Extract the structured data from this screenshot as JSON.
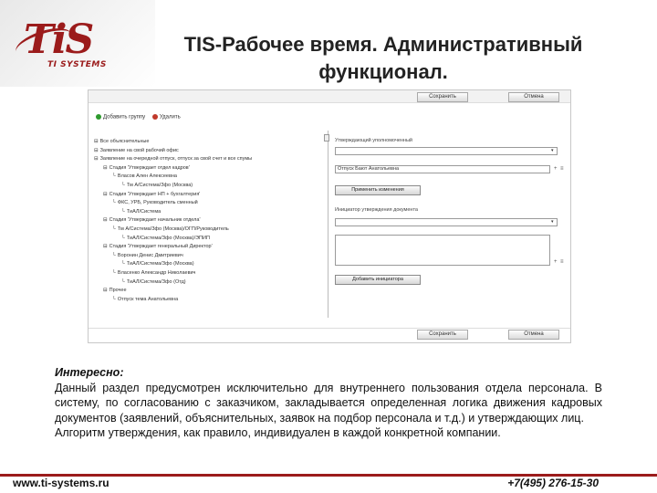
{
  "header": {
    "logo_text": "TiS",
    "logo_sub": "TI SYSTEMS",
    "title_line1": "TIS-Рабочее время. Административный",
    "title_line2": "функционал."
  },
  "screenshot": {
    "top_buttons": [
      "Сохранить",
      "Отмена"
    ],
    "toolbar": [
      {
        "label": "Добавить группу",
        "icon": "add-icon",
        "color": "#2e9a2e"
      },
      {
        "label": "Удалить",
        "icon": "delete-icon",
        "color": "#c0392b"
      }
    ],
    "tree": [
      {
        "indent": 0,
        "text": "Все объяснительные"
      },
      {
        "indent": 0,
        "text": "Заявление на свой рабочий офис"
      },
      {
        "indent": 0,
        "text": "Заявление на очередной отпуск, отпуск за свой счет и все спумы"
      },
      {
        "indent": 1,
        "text": "Стадия 'Утверждает отдел кадров'"
      },
      {
        "indent": 2,
        "text": "Власов Ален Алексеевна"
      },
      {
        "indent": 3,
        "text": "Тм А/Система/Зфо (Москва)"
      },
      {
        "indent": 1,
        "text": "Стадия 'Утверждает НП + бухгалтерия'"
      },
      {
        "indent": 2,
        "text": "ФКС, УРБ, Руководитель сменный"
      },
      {
        "indent": 3,
        "text": "ТиАЛ/Система"
      },
      {
        "indent": 1,
        "text": "Стадия 'Утверждает начальник отдела'"
      },
      {
        "indent": 2,
        "text": "Тм А/Система/Зфо (Москва)/ОГП/Руководитель"
      },
      {
        "indent": 3,
        "text": "ТиАЛ/Система/Зфо (Москва)/ЭПИП"
      },
      {
        "indent": 1,
        "text": "Стадия 'Утверждает генеральный Директор'"
      },
      {
        "indent": 2,
        "text": "Воронин Денис Дмитриевич"
      },
      {
        "indent": 3,
        "text": "ТиАЛ/Система/Зфо (Москва)"
      },
      {
        "indent": 2,
        "text": "Власенко Александр Николаевич"
      },
      {
        "indent": 3,
        "text": "ТиАЛ/Система/Зфо (Отд)"
      },
      {
        "indent": 1,
        "text": "Прочее"
      },
      {
        "indent": 2,
        "text": "Отпуск тема Анатольевна"
      }
    ],
    "right": {
      "label1": "Утверждающий уполномоченный",
      "field2_value": "Отпуск Бают Анатольевна",
      "apply_button": "Применить изменения",
      "label2": "Инициатор утверждения документа",
      "add_button": "Добавить инициатора"
    },
    "bottom_buttons": [
      "Сохранить",
      "Отмена"
    ]
  },
  "note": {
    "heading": "Интересно:",
    "body": "Данный раздел предусмотрен исключительно для внутреннего пользования отдела персонала. В систему, по согласованию с заказчиком, закладывается определенная логика движения кадровых документов (заявлений, объяснительных, заявок на подбор персонала и т.д.) и утверждающих лиц.",
    "body2": "Алгоритм утверждения, как правило, индивидуален в каждой конкретной компании."
  },
  "footer": {
    "website": "www.ti-systems.ru",
    "phone": "+7(495) 276-15-30"
  },
  "colors": {
    "brand": "#9b1b1b"
  }
}
